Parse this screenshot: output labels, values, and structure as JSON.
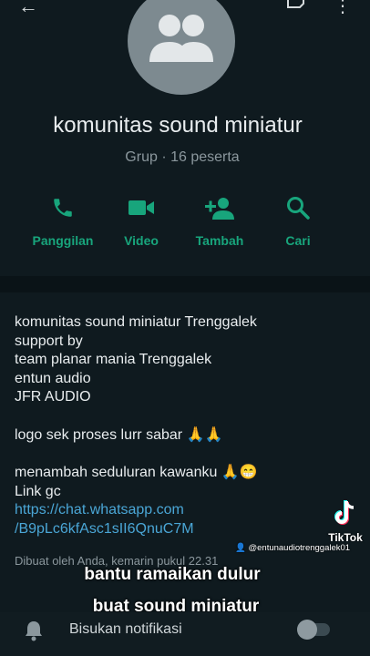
{
  "header": {
    "back_icon": "arrow-left-icon",
    "edit_icon": "edit-icon",
    "more_icon": "more-vertical-icon"
  },
  "group": {
    "name": "komunitas sound miniatur",
    "subtitle": "Grup · 16 peserta"
  },
  "actions": [
    {
      "label": "Panggilan",
      "icon": "phone-icon"
    },
    {
      "label": "Video",
      "icon": "video-icon"
    },
    {
      "label": "Tambah",
      "icon": "add-person-icon"
    },
    {
      "label": "Cari",
      "icon": "search-icon"
    }
  ],
  "description": {
    "lines": [
      "komunitas sound miniatur Trenggalek",
      "support by",
      "team planar mania Trenggalek",
      "entun audio",
      "JFR AUDIO",
      "logo sek proses lurr sabar 🙏🙏",
      "menambah seduluran kawanku 🙏😁",
      "Link gc"
    ],
    "link_lines": [
      "https://chat.whatsapp.com",
      "/B9pLc6kfAsc1sII6QnuC7M"
    ],
    "created": "Dibuat oleh Anda, kemarin pukul 22.31"
  },
  "overlay": {
    "caption_line1": "bantu ramaikan dulur",
    "caption_line2": "buat sound miniatur",
    "tiktok_label": "TikTok",
    "tiktok_handle": "@entunaudiotrenggalek01"
  },
  "mute": {
    "label": "Bisukan notifikasi",
    "enabled": false
  },
  "colors": {
    "accent": "#18a57c",
    "link": "#4aa6d6",
    "background": "#0f1a1f"
  }
}
